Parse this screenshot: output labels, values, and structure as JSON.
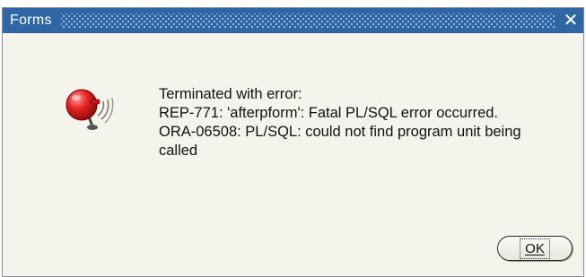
{
  "window": {
    "title": "Forms",
    "close_glyph": "✕",
    "title_bar_color": "#2f67a6",
    "body_color": "#f4f4ec"
  },
  "icon": {
    "name": "alarm-bell-icon",
    "color": "#e02020"
  },
  "message": {
    "lines": [
      "Terminated with error:",
      "REP-771: 'afterpform': Fatal PL/SQL error occurred.",
      "ORA-06508: PL/SQL: could not find program unit being",
      "called"
    ]
  },
  "buttons": {
    "ok_label": "OK"
  }
}
